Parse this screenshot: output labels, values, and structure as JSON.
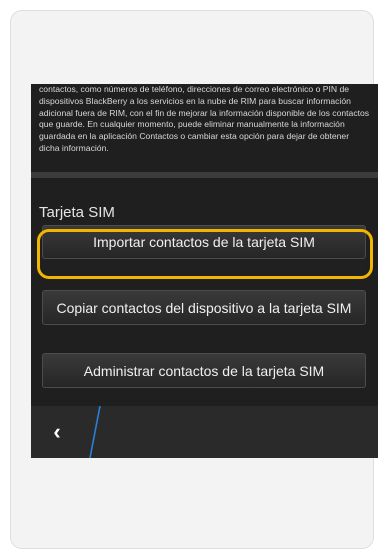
{
  "info_paragraph": "contactos, como números de teléfono, direcciones de correo electrónico o PIN de dispositivos BlackBerry a los servicios en la nube de RIM para buscar información adicional fuera de RIM, con el fin de mejorar la información disponible de los contactos que guarde. En cualquier momento, puede eliminar manualmente la información guardada en la aplicación Contactos o cambiar esta opción para dejar de obtener dicha información.",
  "section_title": "Tarjeta SIM",
  "buttons": {
    "import": "Importar contactos de la tarjeta SIM",
    "copy": "Copiar contactos del dispositivo a la tarjeta SIM",
    "manage": "Administrar contactos de la tarjeta SIM"
  },
  "bottom_bar": {
    "back_icon": "‹"
  },
  "colors": {
    "highlight": "#f2b600",
    "screen_bg": "#1f1f1f",
    "card_bg": "#f3f3f4",
    "accent_line": "#2a7fd6"
  }
}
